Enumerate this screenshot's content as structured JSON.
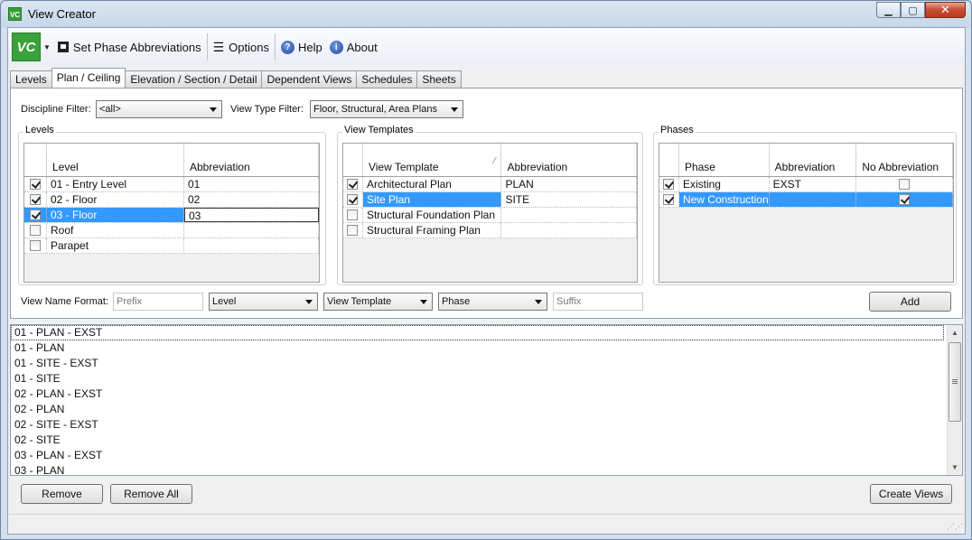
{
  "window": {
    "title": "View Creator",
    "icon_text": "VC",
    "minimize_icon": "minimize-icon",
    "maximize_icon": "maximize-icon",
    "close_icon": "close-icon"
  },
  "toolbar": {
    "logo_text": "VC",
    "set_phase_label": "Set Phase Abbreviations",
    "options_label": "Options",
    "help_label": "Help",
    "about_label": "About"
  },
  "tabs": [
    {
      "label": "Levels"
    },
    {
      "label": "Plan / Ceiling",
      "active": true
    },
    {
      "label": "Elevation / Section / Detail"
    },
    {
      "label": "Dependent Views"
    },
    {
      "label": "Schedules"
    },
    {
      "label": "Sheets"
    }
  ],
  "filters": {
    "discipline_label": "Discipline Filter:",
    "discipline_value": "<all>",
    "view_type_label": "View Type Filter:",
    "view_type_value": "Floor, Structural, Area Plans"
  },
  "levels": {
    "title": "Levels",
    "columns": [
      "Level",
      "Abbreviation"
    ],
    "rows": [
      {
        "checked": true,
        "name": "01 - Entry Level",
        "abbr": "01"
      },
      {
        "checked": true,
        "name": "02 - Floor",
        "abbr": "02"
      },
      {
        "checked": true,
        "name": "03 - Floor",
        "abbr": "03",
        "selected": true
      },
      {
        "checked": false,
        "name": "Roof",
        "abbr": ""
      },
      {
        "checked": false,
        "name": "Parapet",
        "abbr": ""
      }
    ]
  },
  "templates": {
    "title": "View Templates",
    "columns": [
      "View Template",
      "Abbreviation"
    ],
    "rows": [
      {
        "checked": true,
        "name": "Architectural Plan",
        "abbr": "PLAN"
      },
      {
        "checked": true,
        "name": "Site Plan",
        "abbr": "SITE",
        "selected": true
      },
      {
        "checked": false,
        "name": "Structural Foundation Plan",
        "abbr": ""
      },
      {
        "checked": false,
        "name": "Structural Framing Plan",
        "abbr": ""
      }
    ]
  },
  "phases": {
    "title": "Phases",
    "columns": [
      "Phase",
      "Abbreviation",
      "No Abbreviation"
    ],
    "rows": [
      {
        "checked": true,
        "name": "Existing",
        "abbr": "EXST",
        "no_abbr": false
      },
      {
        "checked": true,
        "name": "New Construction",
        "abbr": "",
        "no_abbr": true,
        "selected": true
      }
    ]
  },
  "format": {
    "label": "View Name Format:",
    "prefix_placeholder": "Prefix",
    "level_value": "Level",
    "template_value": "View Template",
    "phase_value": "Phase",
    "suffix_placeholder": "Suffix",
    "add_label": "Add"
  },
  "results": [
    "01  - PLAN  - EXST",
    "01  - PLAN",
    "01  - SITE  - EXST",
    "01  - SITE",
    "02  - PLAN  - EXST",
    "02  - PLAN",
    "02  - SITE  - EXST",
    "02  - SITE",
    "03  - PLAN  - EXST",
    "03  - PLAN"
  ],
  "bottom": {
    "remove_label": "Remove",
    "remove_all_label": "Remove All",
    "create_label": "Create Views"
  },
  "colors": {
    "selection": "#3399ff",
    "logo_green": "#3aa23a",
    "close_red": "#c74c32"
  }
}
